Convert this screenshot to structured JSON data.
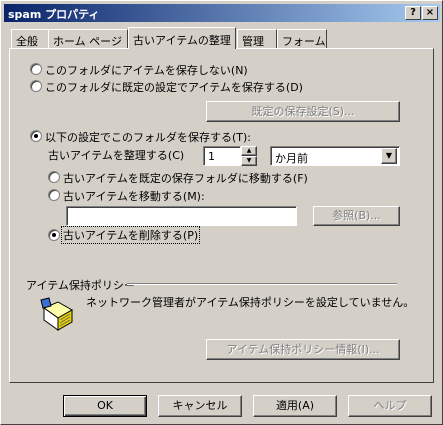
{
  "window": {
    "title": "spam プロパティ",
    "help_button": "?",
    "close_button": "×"
  },
  "tabs": [
    {
      "label": "全般"
    },
    {
      "label": "ホーム ページ"
    },
    {
      "label": "古いアイテムの整理"
    },
    {
      "label": "管理"
    },
    {
      "label": "フォーム"
    }
  ],
  "archive": {
    "option_no_archive": "このフォルダにアイテムを保存しない(N)",
    "option_default_archive": "このフォルダに既定の設定でアイテムを保存する(D)",
    "default_settings_button": "既定の保存設定(S)...",
    "option_custom_archive": "以下の設定でこのフォルダを保存する(T):",
    "clean_label": "古いアイテムを整理する(C)",
    "clean_value": "1",
    "clean_unit": "か月前",
    "move_default_folder": "古いアイテムを既定の保存フォルダに移動する(F)",
    "move_to": "古いアイテムを移動する(M):",
    "move_path": "",
    "browse_button": "参照(B)...",
    "delete_old": "古いアイテムを削除する(P)"
  },
  "policy": {
    "section_title": "アイテム保持ポリシー",
    "message": "ネットワーク管理者がアイテム保持ポリシーを設定していません。",
    "info_button": "アイテム保持ポリシー情報(I)..."
  },
  "footer": {
    "ok": "OK",
    "cancel": "キャンセル",
    "apply": "適用(A)",
    "help": "ヘルプ"
  }
}
